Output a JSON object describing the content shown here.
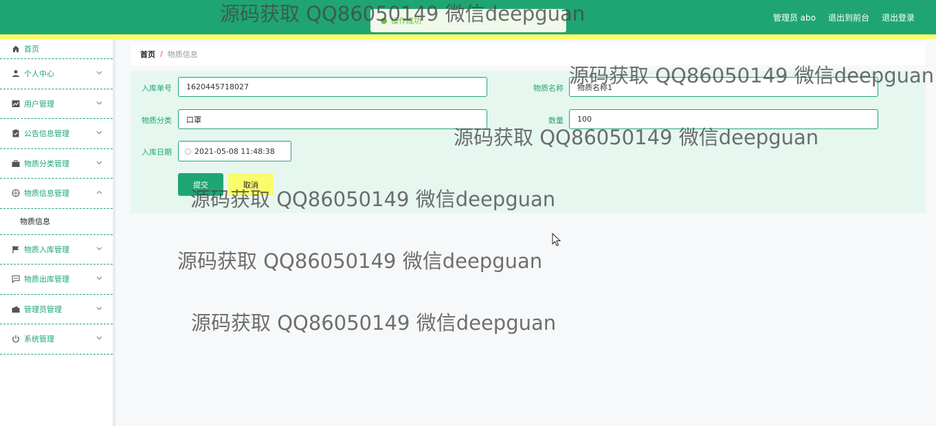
{
  "header": {
    "links": [
      "管理员 abo",
      "退出到前台",
      "退出登录"
    ]
  },
  "toast": {
    "text": "操作成功"
  },
  "sidebar": {
    "items": [
      {
        "label": "首页",
        "icon": "home-icon"
      },
      {
        "label": "个人中心",
        "icon": "user-icon"
      },
      {
        "label": "用户管理",
        "icon": "chart-icon"
      },
      {
        "label": "公告信息管理",
        "icon": "clipboard-icon"
      },
      {
        "label": "物质分类管理",
        "icon": "briefcase-icon"
      },
      {
        "label": "物质信息管理",
        "icon": "compass-icon",
        "expanded": true,
        "children": [
          "物质信息"
        ]
      },
      {
        "label": "物质入库管理",
        "icon": "flag-icon"
      },
      {
        "label": "物质出库管理",
        "icon": "chat-icon"
      },
      {
        "label": "管理员管理",
        "icon": "wallet-icon"
      },
      {
        "label": "系统管理",
        "icon": "power-icon"
      }
    ]
  },
  "breadcrumb": {
    "home": "首页",
    "separator": "/",
    "current": "物质信息"
  },
  "form": {
    "fields": {
      "order_no": {
        "label": "入库单号",
        "value": "1620445718027"
      },
      "material_name": {
        "label": "物质名称",
        "value": "物质名称1"
      },
      "category": {
        "label": "物质分类",
        "value": "口罩"
      },
      "quantity": {
        "label": "数量",
        "value": "100"
      },
      "date": {
        "label": "入库日期",
        "value": "2021-05-08 11:48:38"
      }
    },
    "submit_label": "提交",
    "cancel_label": "取消"
  },
  "watermark": {
    "text": "源码获取 QQ86050149 微信deepguan"
  },
  "colors": {
    "primary": "#1fa573",
    "accent": "#fbfc6b",
    "panel": "#e6f7f0"
  }
}
